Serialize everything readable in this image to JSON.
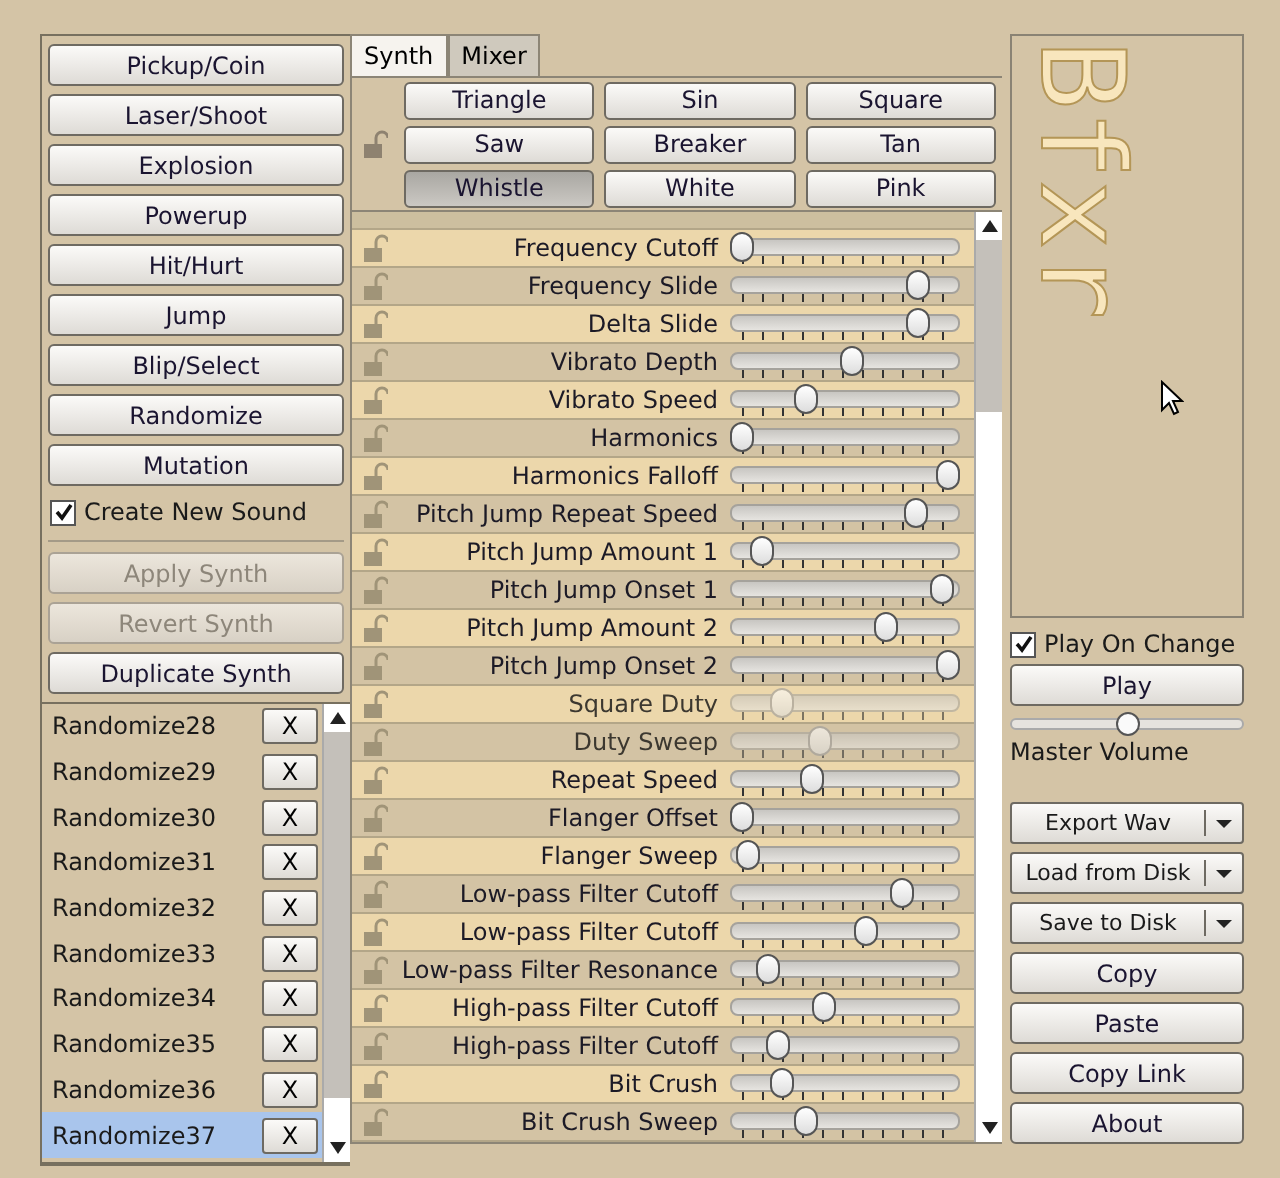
{
  "presets": [
    "Pickup/Coin",
    "Laser/Shoot",
    "Explosion",
    "Powerup",
    "Hit/Hurt",
    "Jump",
    "Blip/Select",
    "Randomize",
    "Mutation"
  ],
  "create_new_sound": {
    "label": "Create New Sound",
    "checked": true
  },
  "synth_buttons": [
    {
      "label": "Apply Synth",
      "disabled": true
    },
    {
      "label": "Revert Synth",
      "disabled": true
    },
    {
      "label": "Duplicate Synth",
      "disabled": false
    }
  ],
  "sounds": [
    {
      "name": "Randomize28",
      "delete": "X",
      "selected": false
    },
    {
      "name": "Randomize29",
      "delete": "X",
      "selected": false
    },
    {
      "name": "Randomize30",
      "delete": "X",
      "selected": false
    },
    {
      "name": "Randomize31",
      "delete": "X",
      "selected": false
    },
    {
      "name": "Randomize32",
      "delete": "X",
      "selected": false
    },
    {
      "name": "Randomize33",
      "delete": "X",
      "selected": false
    },
    {
      "name": "Randomize34",
      "delete": "X",
      "selected": false
    },
    {
      "name": "Randomize35",
      "delete": "X",
      "selected": false
    },
    {
      "name": "Randomize36",
      "delete": "X",
      "selected": false
    },
    {
      "name": "Randomize37",
      "delete": "X",
      "selected": true
    }
  ],
  "tabs": [
    {
      "label": "Synth",
      "selected": true
    },
    {
      "label": "Mixer",
      "selected": false
    }
  ],
  "waveforms": [
    {
      "label": "Triangle",
      "selected": false
    },
    {
      "label": "Sin",
      "selected": false
    },
    {
      "label": "Square",
      "selected": false
    },
    {
      "label": "Saw",
      "selected": false
    },
    {
      "label": "Breaker",
      "selected": false
    },
    {
      "label": "Tan",
      "selected": false
    },
    {
      "label": "Whistle",
      "selected": true
    },
    {
      "label": "White",
      "selected": false
    },
    {
      "label": "Pink",
      "selected": false
    }
  ],
  "parameters": [
    {
      "label": "Frequency Cutoff",
      "level": 0,
      "disabled": false
    },
    {
      "label": "Frequency Slide",
      "level": 0.85,
      "disabled": false
    },
    {
      "label": "Delta Slide",
      "level": 0.85,
      "disabled": false
    },
    {
      "label": "Vibrato Depth",
      "level": 0.53,
      "disabled": false
    },
    {
      "label": "Vibrato Speed",
      "level": 0.31,
      "disabled": false
    },
    {
      "label": "Harmonics",
      "level": 0,
      "disabled": false
    },
    {
      "label": "Harmonics Falloff",
      "level": 1,
      "disabled": false
    },
    {
      "label": "Pitch Jump Repeat Speed",
      "level": 0.84,
      "disabled": false
    },
    {
      "label": "Pitch Jump Amount 1",
      "level": 0.1,
      "disabled": false
    },
    {
      "label": "Pitch Jump Onset 1",
      "level": 0.97,
      "disabled": false
    },
    {
      "label": "Pitch Jump Amount 2",
      "level": 0.7,
      "disabled": false
    },
    {
      "label": "Pitch Jump Onset 2",
      "level": 1,
      "disabled": false
    },
    {
      "label": "Square Duty",
      "level": 0.19,
      "disabled": true
    },
    {
      "label": "Duty Sweep",
      "level": 0.38,
      "disabled": true
    },
    {
      "label": "Repeat Speed",
      "level": 0.34,
      "disabled": false
    },
    {
      "label": "Flanger Offset",
      "level": 0,
      "disabled": false
    },
    {
      "label": "Flanger Sweep",
      "level": 0.03,
      "disabled": false
    },
    {
      "label": "Low-pass Filter Cutoff",
      "level": 0.78,
      "disabled": false
    },
    {
      "label": "Low-pass Filter Cutoff",
      "level": 0.6,
      "disabled": false
    },
    {
      "label": "Low-pass Filter Resonance",
      "level": 0.13,
      "disabled": false
    },
    {
      "label": "High-pass Filter Cutoff",
      "level": 0.4,
      "disabled": false
    },
    {
      "label": "High-pass Filter Cutoff",
      "level": 0.17,
      "disabled": false
    },
    {
      "label": "Bit Crush",
      "level": 0.19,
      "disabled": false
    },
    {
      "label": "Bit Crush Sweep",
      "level": 0.31,
      "disabled": false
    }
  ],
  "logo": "Bfxr",
  "play_on_change": {
    "label": "Play On Change",
    "checked": true
  },
  "play": "Play",
  "master_volume": {
    "label": "Master Volume",
    "level": 0.5
  },
  "file_buttons": [
    "Export Wav",
    "Load from Disk",
    "Save to Disk"
  ],
  "buttons": [
    "Copy",
    "Paste",
    "Copy Link",
    "About"
  ]
}
